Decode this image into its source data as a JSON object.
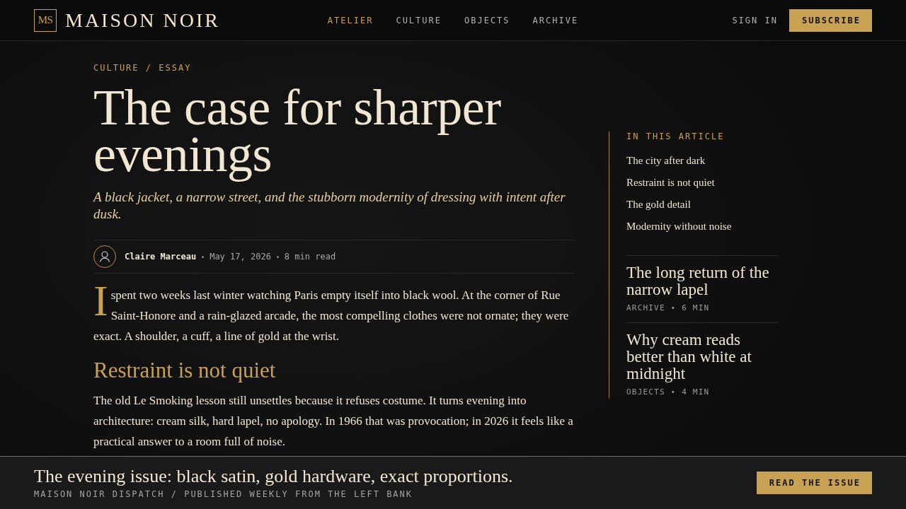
{
  "header": {
    "logo": {
      "monogram": "MS",
      "name": "MAISON NOIR"
    },
    "nav": [
      {
        "label": "ATELIER",
        "selected": true
      },
      {
        "label": "CULTURE",
        "selected": false
      },
      {
        "label": "OBJECTS",
        "selected": false
      },
      {
        "label": "ARCHIVE",
        "selected": false
      }
    ],
    "sign_in": "SIGN IN",
    "subscribe": "SUBSCRIBE"
  },
  "article": {
    "kicker": "CULTURE / ESSAY",
    "title": "The case for sharper evenings",
    "subtitle": "A black jacket, a narrow street, and the stubborn modernity of dressing with intent after dusk.",
    "byline": {
      "author": "Claire Marceau",
      "date": "May 17, 2026",
      "read_time": "8 min read"
    },
    "body": [
      {
        "kind": "paragraph",
        "drop_cap": "I",
        "text": "spent two weeks last winter watching Paris empty itself into black wool. At the corner of Rue Saint-Honore and a rain-glazed arcade, the most compelling clothes were not ornate; they were exact. A shoulder, a cuff, a line of gold at the wrist."
      },
      {
        "kind": "heading",
        "text": "Restraint is not quiet"
      },
      {
        "kind": "paragraph",
        "text": "The old Le Smoking lesson still unsettles because it refuses costume. It turns evening into architecture: cream silk, hard lapel, no apology. In 1966 that was provocation; in 2026 it feels like a practical answer to a room full of noise."
      }
    ]
  },
  "sidebar": {
    "toc": {
      "heading": "IN THIS ARTICLE",
      "items": [
        "The city after dark",
        "Restraint is not quiet",
        "The gold detail",
        "Modernity without noise"
      ]
    },
    "related": [
      {
        "title": "The long return of the narrow lapel",
        "meta": "ARCHIVE • 6 MIN"
      },
      {
        "title": "Why cream reads better than white at midnight",
        "meta": "OBJECTS • 4 MIN"
      }
    ]
  },
  "footer": {
    "headline": "The evening issue: black satin, gold hardware, exact proportions.",
    "tagline": "MAISON NOIR DISPATCH / PUBLISHED WEEKLY FROM THE LEFT BANK",
    "button": "READ THE ISSUE"
  }
}
